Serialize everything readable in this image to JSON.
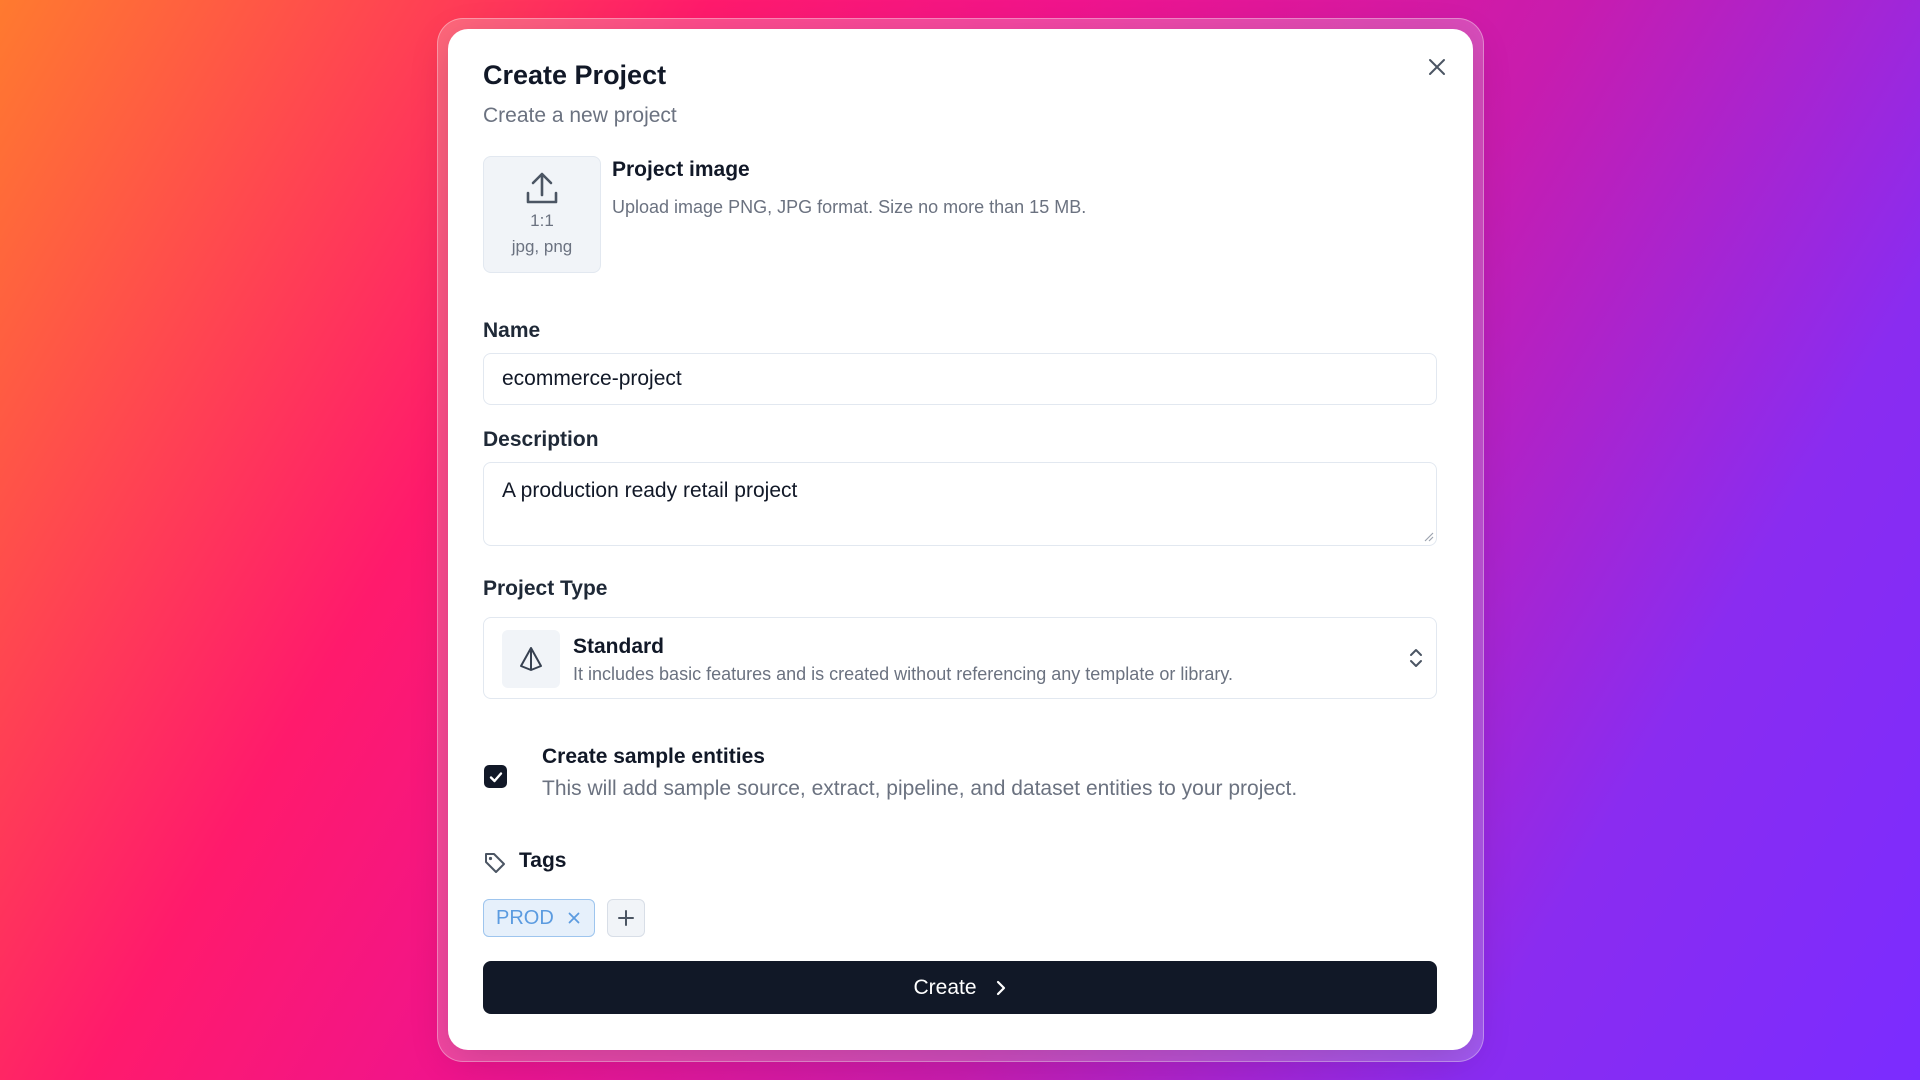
{
  "dialog": {
    "title": "Create Project",
    "subtitle": "Create a new project"
  },
  "project_image": {
    "ratio": "1:1",
    "formats": "jpg, png",
    "label": "Project image",
    "help": "Upload image PNG, JPG format. Size no more than 15 MB."
  },
  "name": {
    "label": "Name",
    "value": "ecommerce-project"
  },
  "description": {
    "label": "Description",
    "value": "A production ready retail project"
  },
  "project_type": {
    "label": "Project Type",
    "selected_title": "Standard",
    "selected_description": "It includes basic features and is created without referencing any template or library.",
    "icon": "cube-icon"
  },
  "sample_entities": {
    "checked": true,
    "title": "Create sample entities",
    "description": "This will add sample source, extract, pipeline, and dataset entities to your project."
  },
  "tags": {
    "label": "Tags",
    "items": [
      "PROD"
    ]
  },
  "submit": {
    "label": "Create"
  },
  "colors": {
    "primary": "#111827",
    "muted_text": "#6b7280",
    "tag_text": "#5b9be0",
    "tag_bg": "#e6f0fb"
  }
}
